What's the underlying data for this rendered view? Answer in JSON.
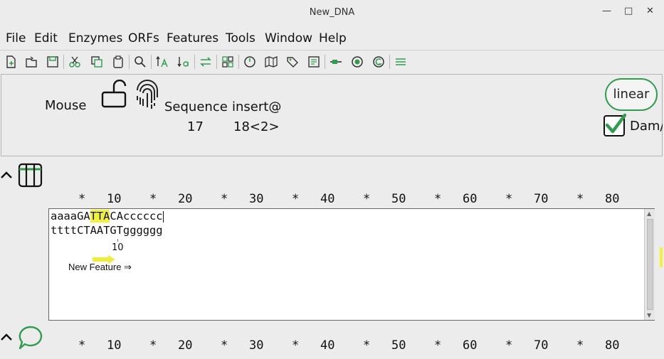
{
  "window": {
    "title": "New_DNA",
    "min_symbol": "—",
    "max_symbol": "□",
    "close_symbol": "✕"
  },
  "menu": [
    "File",
    "Edit",
    "Enzymes",
    "ORFs",
    "Features",
    "Tools",
    "Window",
    "Help"
  ],
  "toolbar_icons": [
    "new-file-icon",
    "open-file-icon",
    "save-icon",
    "cut-icon",
    "copy-icon",
    "paste-icon",
    "search-icon",
    "upper-case-icon",
    "lower-case-icon",
    "reverse-complement-icon",
    "grid-view-icon",
    "circular-map-icon",
    "map-icon",
    "tag-icon",
    "document-view-icon",
    "linear-map-icon",
    "enzyme-icon",
    "gc-icon",
    "menu-lines-icon"
  ],
  "info_panel": {
    "mouse_label": "Mouse",
    "sequence_label": "Sequence",
    "sequence_value": "17",
    "insert_label": "insert@",
    "insert_value": "18<2>",
    "linear_label": "linear",
    "dam_label": "Dam/"
  },
  "ruler_top": [
    "*",
    "10",
    "*",
    "20",
    "*",
    "30",
    "*",
    "40",
    "*",
    "50",
    "*",
    "60",
    "*",
    "70",
    "*",
    "80"
  ],
  "ruler_bottom": [
    "*",
    "10",
    "*",
    "20",
    "*",
    "30",
    "*",
    "40",
    "*",
    "50",
    "*",
    "60",
    "*",
    "70",
    "*",
    "80"
  ],
  "sequence": {
    "top_before": "aaaaGA",
    "top_highlight": "TTA",
    "top_after": "CAcccccc",
    "bottom": "ttttCTAATGTgggggg",
    "tick_label": "10",
    "feature_label": "New Feature ⇒"
  },
  "colors": {
    "accent_green": "#2e9e4e",
    "highlight_yellow": "#f2f23a"
  }
}
